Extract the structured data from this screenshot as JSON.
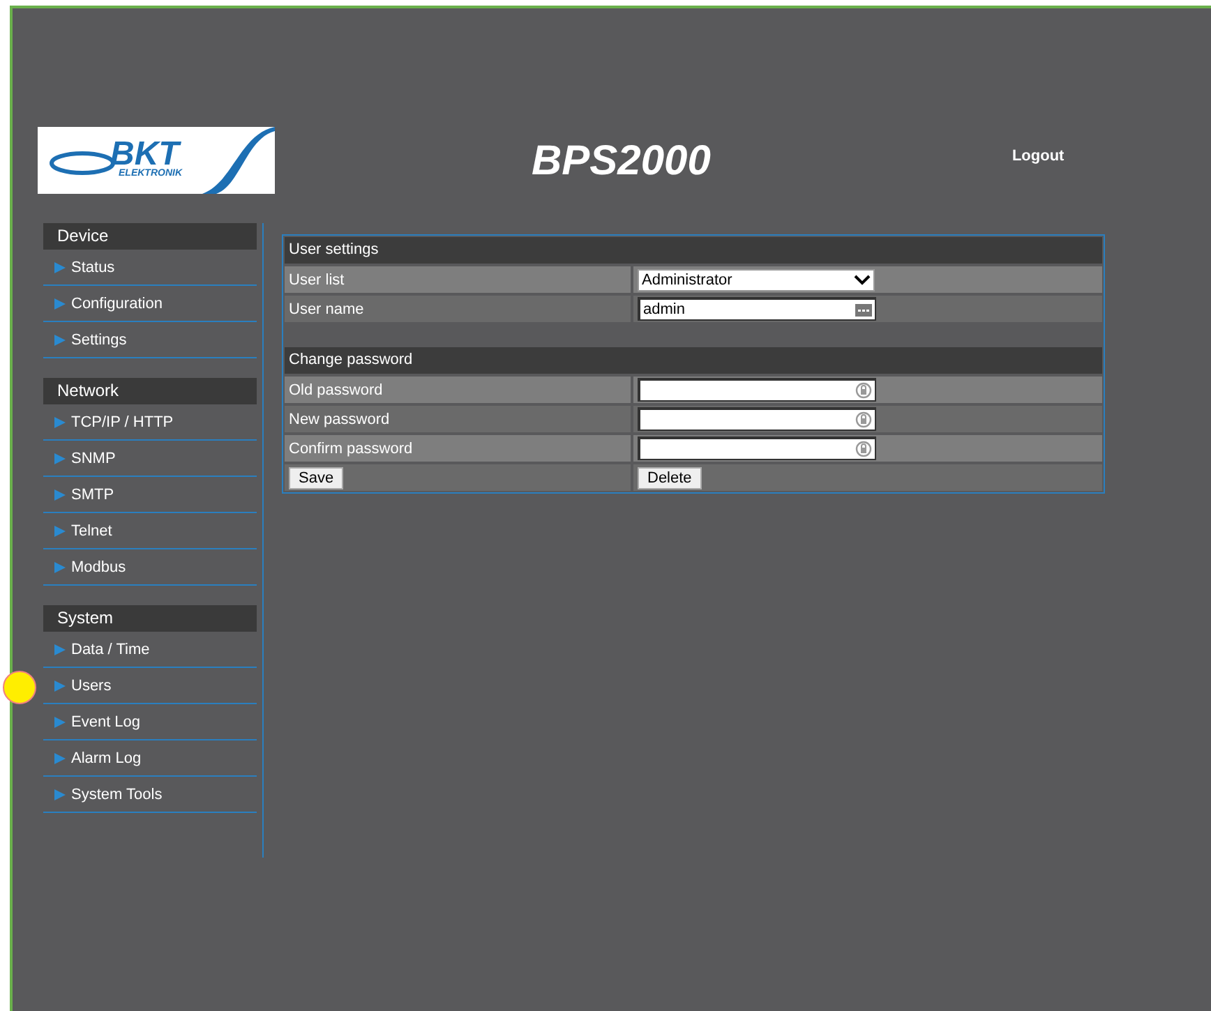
{
  "header": {
    "logo": {
      "name": "BKT",
      "sub": "ELEKTRONIK"
    },
    "title": "BPS2000",
    "logout": "Logout"
  },
  "sidebar": {
    "sections": [
      {
        "title": "Device",
        "items": [
          "Status",
          "Configuration",
          "Settings"
        ]
      },
      {
        "title": "Network",
        "items": [
          "TCP/IP / HTTP",
          "SNMP",
          "SMTP",
          "Telnet",
          "Modbus"
        ]
      },
      {
        "title": "System",
        "items": [
          "Data / Time",
          "Users",
          "Event Log",
          "Alarm Log",
          "System Tools"
        ]
      }
    ]
  },
  "form": {
    "sections": [
      {
        "title": "User settings",
        "rows": [
          {
            "kind": "select",
            "label": "User list",
            "value": "Administrator"
          },
          {
            "kind": "text",
            "label": "User name",
            "value": "admin"
          }
        ]
      },
      {
        "title": "Change password",
        "rows": [
          {
            "kind": "password",
            "label": "Old password"
          },
          {
            "kind": "password",
            "label": "New password"
          },
          {
            "kind": "password",
            "label": "Confirm password"
          }
        ]
      }
    ],
    "buttons": [
      "Save",
      "Delete"
    ]
  }
}
